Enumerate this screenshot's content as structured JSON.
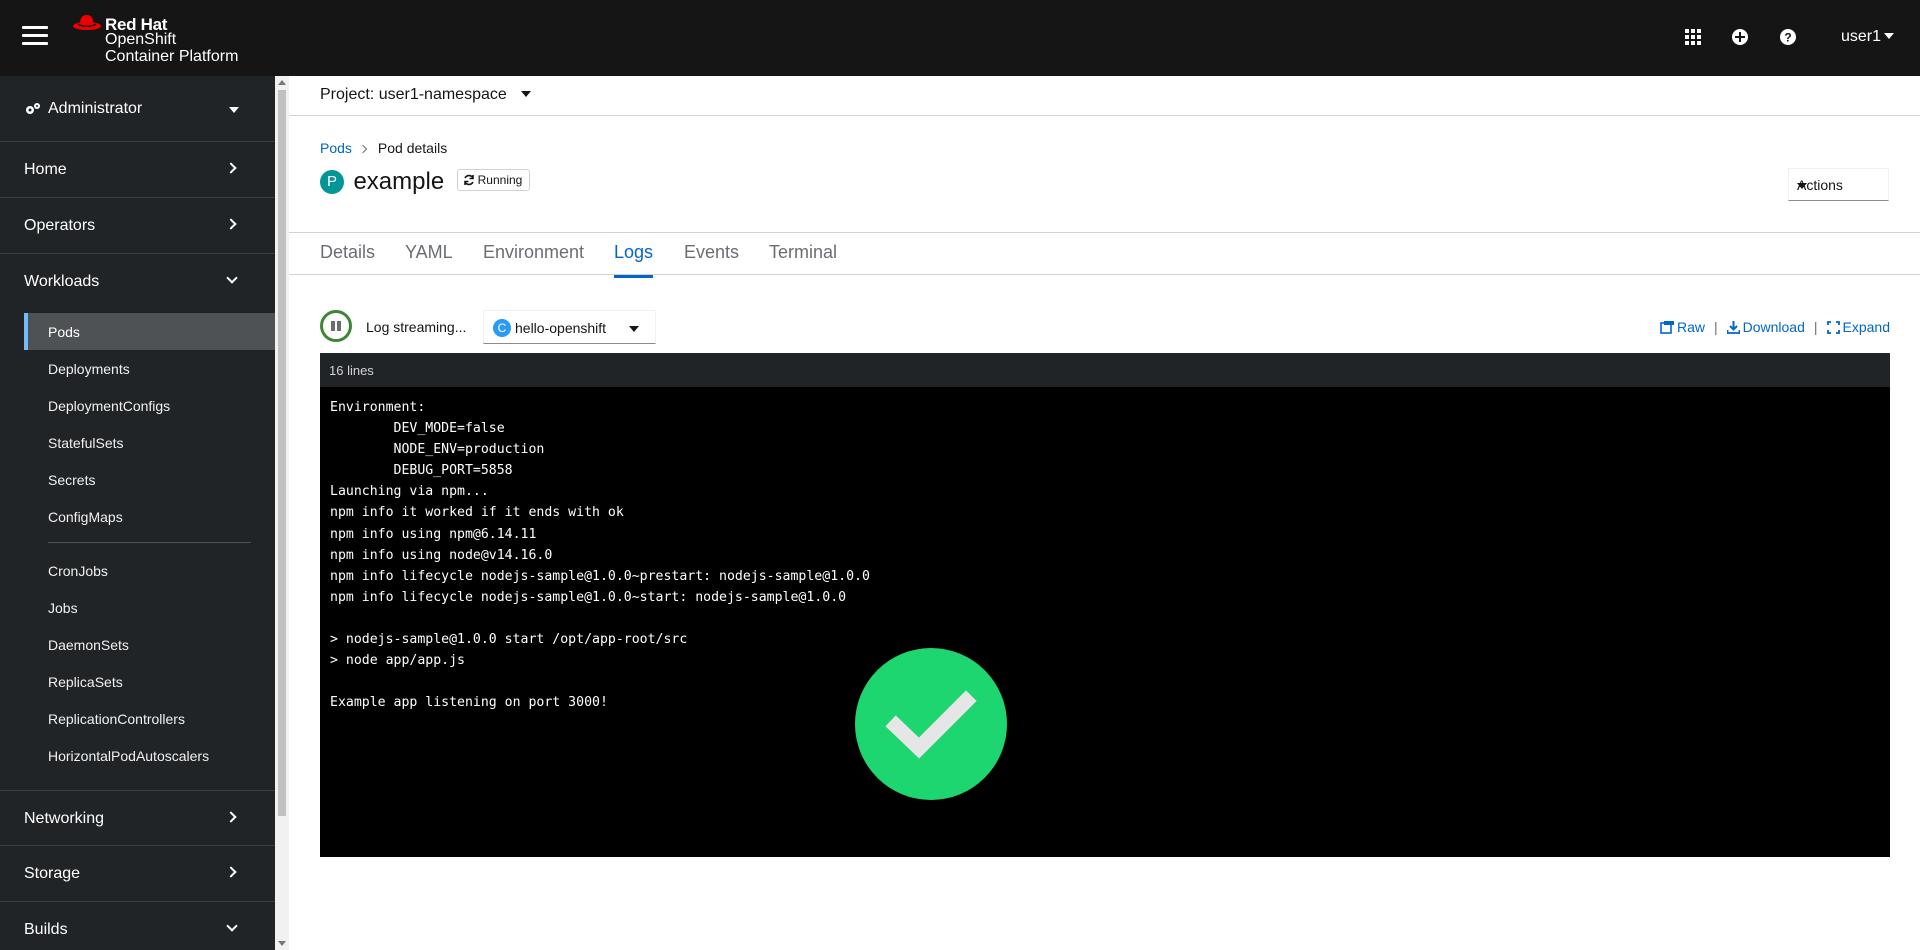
{
  "masthead": {
    "brand": {
      "line1": "Red Hat",
      "line2": "OpenShift",
      "line3": "Container Platform"
    },
    "icons": [
      "app-launcher-icon",
      "plus-circle-icon",
      "help-icon"
    ],
    "user": "user1"
  },
  "sidebar": {
    "perspective": "Administrator",
    "sections": {
      "home": "Home",
      "operators": "Operators",
      "workloads": "Workloads",
      "networking": "Networking",
      "storage": "Storage",
      "builds": "Builds"
    },
    "workload_items": {
      "pods": "Pods",
      "deployments": "Deployments",
      "deploymentconfigs": "DeploymentConfigs",
      "statefulsets": "StatefulSets",
      "secrets": "Secrets",
      "configmaps": "ConfigMaps",
      "cronjobs": "CronJobs",
      "jobs": "Jobs",
      "daemonsets": "DaemonSets",
      "replicasets": "ReplicaSets",
      "replicationcontrollers": "ReplicationControllers",
      "hpa": "HorizontalPodAutoscalers"
    },
    "active_item": "Pods"
  },
  "project": {
    "label": "Project: user1-namespace"
  },
  "breadcrumb": {
    "parent": "Pods",
    "current": "Pod details"
  },
  "pod": {
    "badge": "P",
    "name": "example",
    "status": "Running"
  },
  "actions_label": "Actions",
  "tabs": {
    "details": "Details",
    "yaml": "YAML",
    "environment": "Environment",
    "logs": "Logs",
    "events": "Events",
    "terminal": "Terminal"
  },
  "active_tab": "Logs",
  "logs": {
    "streaming_label": "Log streaming...",
    "container_badge": "C",
    "container": "hello-openshift",
    "raw": "Raw",
    "download": "Download",
    "expand": "Expand",
    "line_count": "16 lines",
    "lines": [
      "Environment:",
      "        DEV_MODE=false",
      "        NODE_ENV=production",
      "        DEBUG_PORT=5858",
      "Launching via npm...",
      "npm info it worked if it ends with ok",
      "npm info using npm@6.14.11",
      "npm info using node@v14.16.0",
      "npm info lifecycle nodejs-sample@1.0.0~prestart: nodejs-sample@1.0.0",
      "npm info lifecycle nodejs-sample@1.0.0~start: nodejs-sample@1.0.0",
      "",
      "> nodejs-sample@1.0.0 start /opt/app-root/src",
      "> node app/app.js",
      "",
      "Example app listening on port 3000!",
      ""
    ]
  },
  "colors": {
    "accent": "#0066cc",
    "success": "#1ed66f",
    "masthead": "#151515",
    "sidebar": "#212427"
  },
  "overlay_icon": "success-check-icon"
}
